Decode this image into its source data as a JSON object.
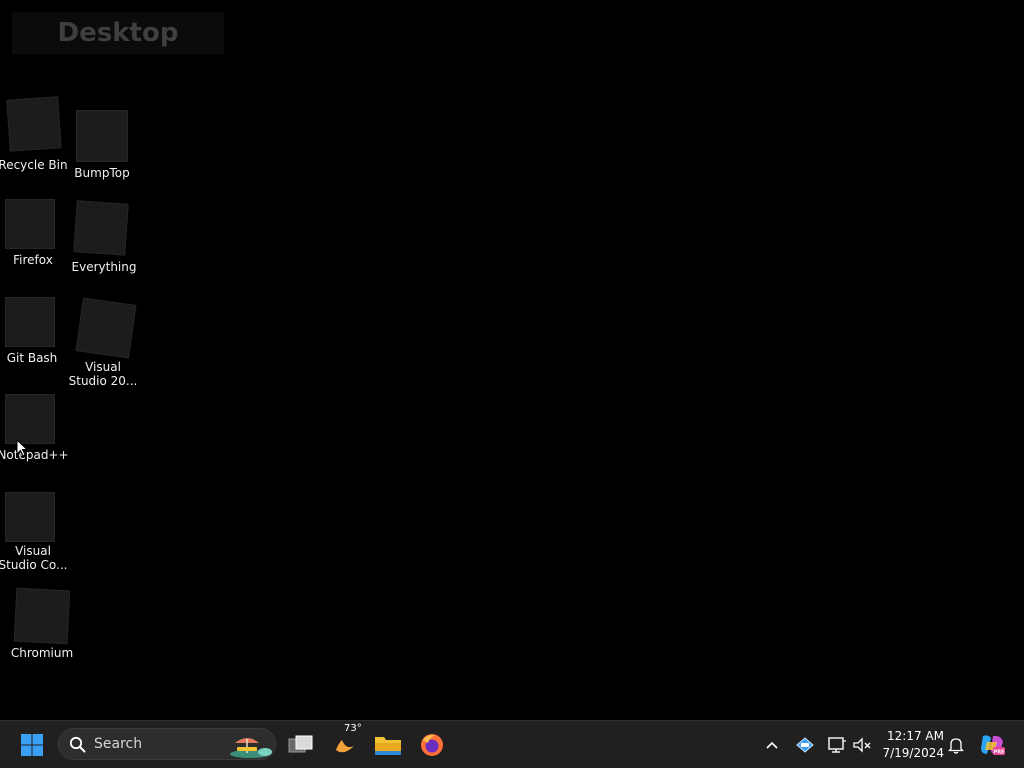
{
  "desktop": {
    "title": "Desktop",
    "icons": [
      {
        "name": "recycle-bin",
        "label": "Recycle Bin"
      },
      {
        "name": "bumptop",
        "label": "BumpTop"
      },
      {
        "name": "firefox",
        "label": "Firefox"
      },
      {
        "name": "everything",
        "label": "Everything"
      },
      {
        "name": "git-bash",
        "label": "Git Bash"
      },
      {
        "name": "visual-studio",
        "label_line1": "Visual",
        "label_line2": "Studio 20..."
      },
      {
        "name": "notepadpp",
        "label": "Notepad++"
      },
      {
        "name": "vscode",
        "label_line1": "Visual",
        "label_line2": "Studio Co..."
      },
      {
        "name": "chromium",
        "label": "Chromium"
      }
    ]
  },
  "taskbar": {
    "search_label": "Search",
    "weather_temp": "73°",
    "clock_time": "12:17 AM",
    "clock_date": "7/19/2024",
    "colors": {
      "taskbar_bg": "#202020",
      "start_blue": "#3aa0f3",
      "explorer_yellow": "#f2c232",
      "firefox_orange": "#ff7139",
      "firefox_purple": "#6b2fbf"
    }
  }
}
